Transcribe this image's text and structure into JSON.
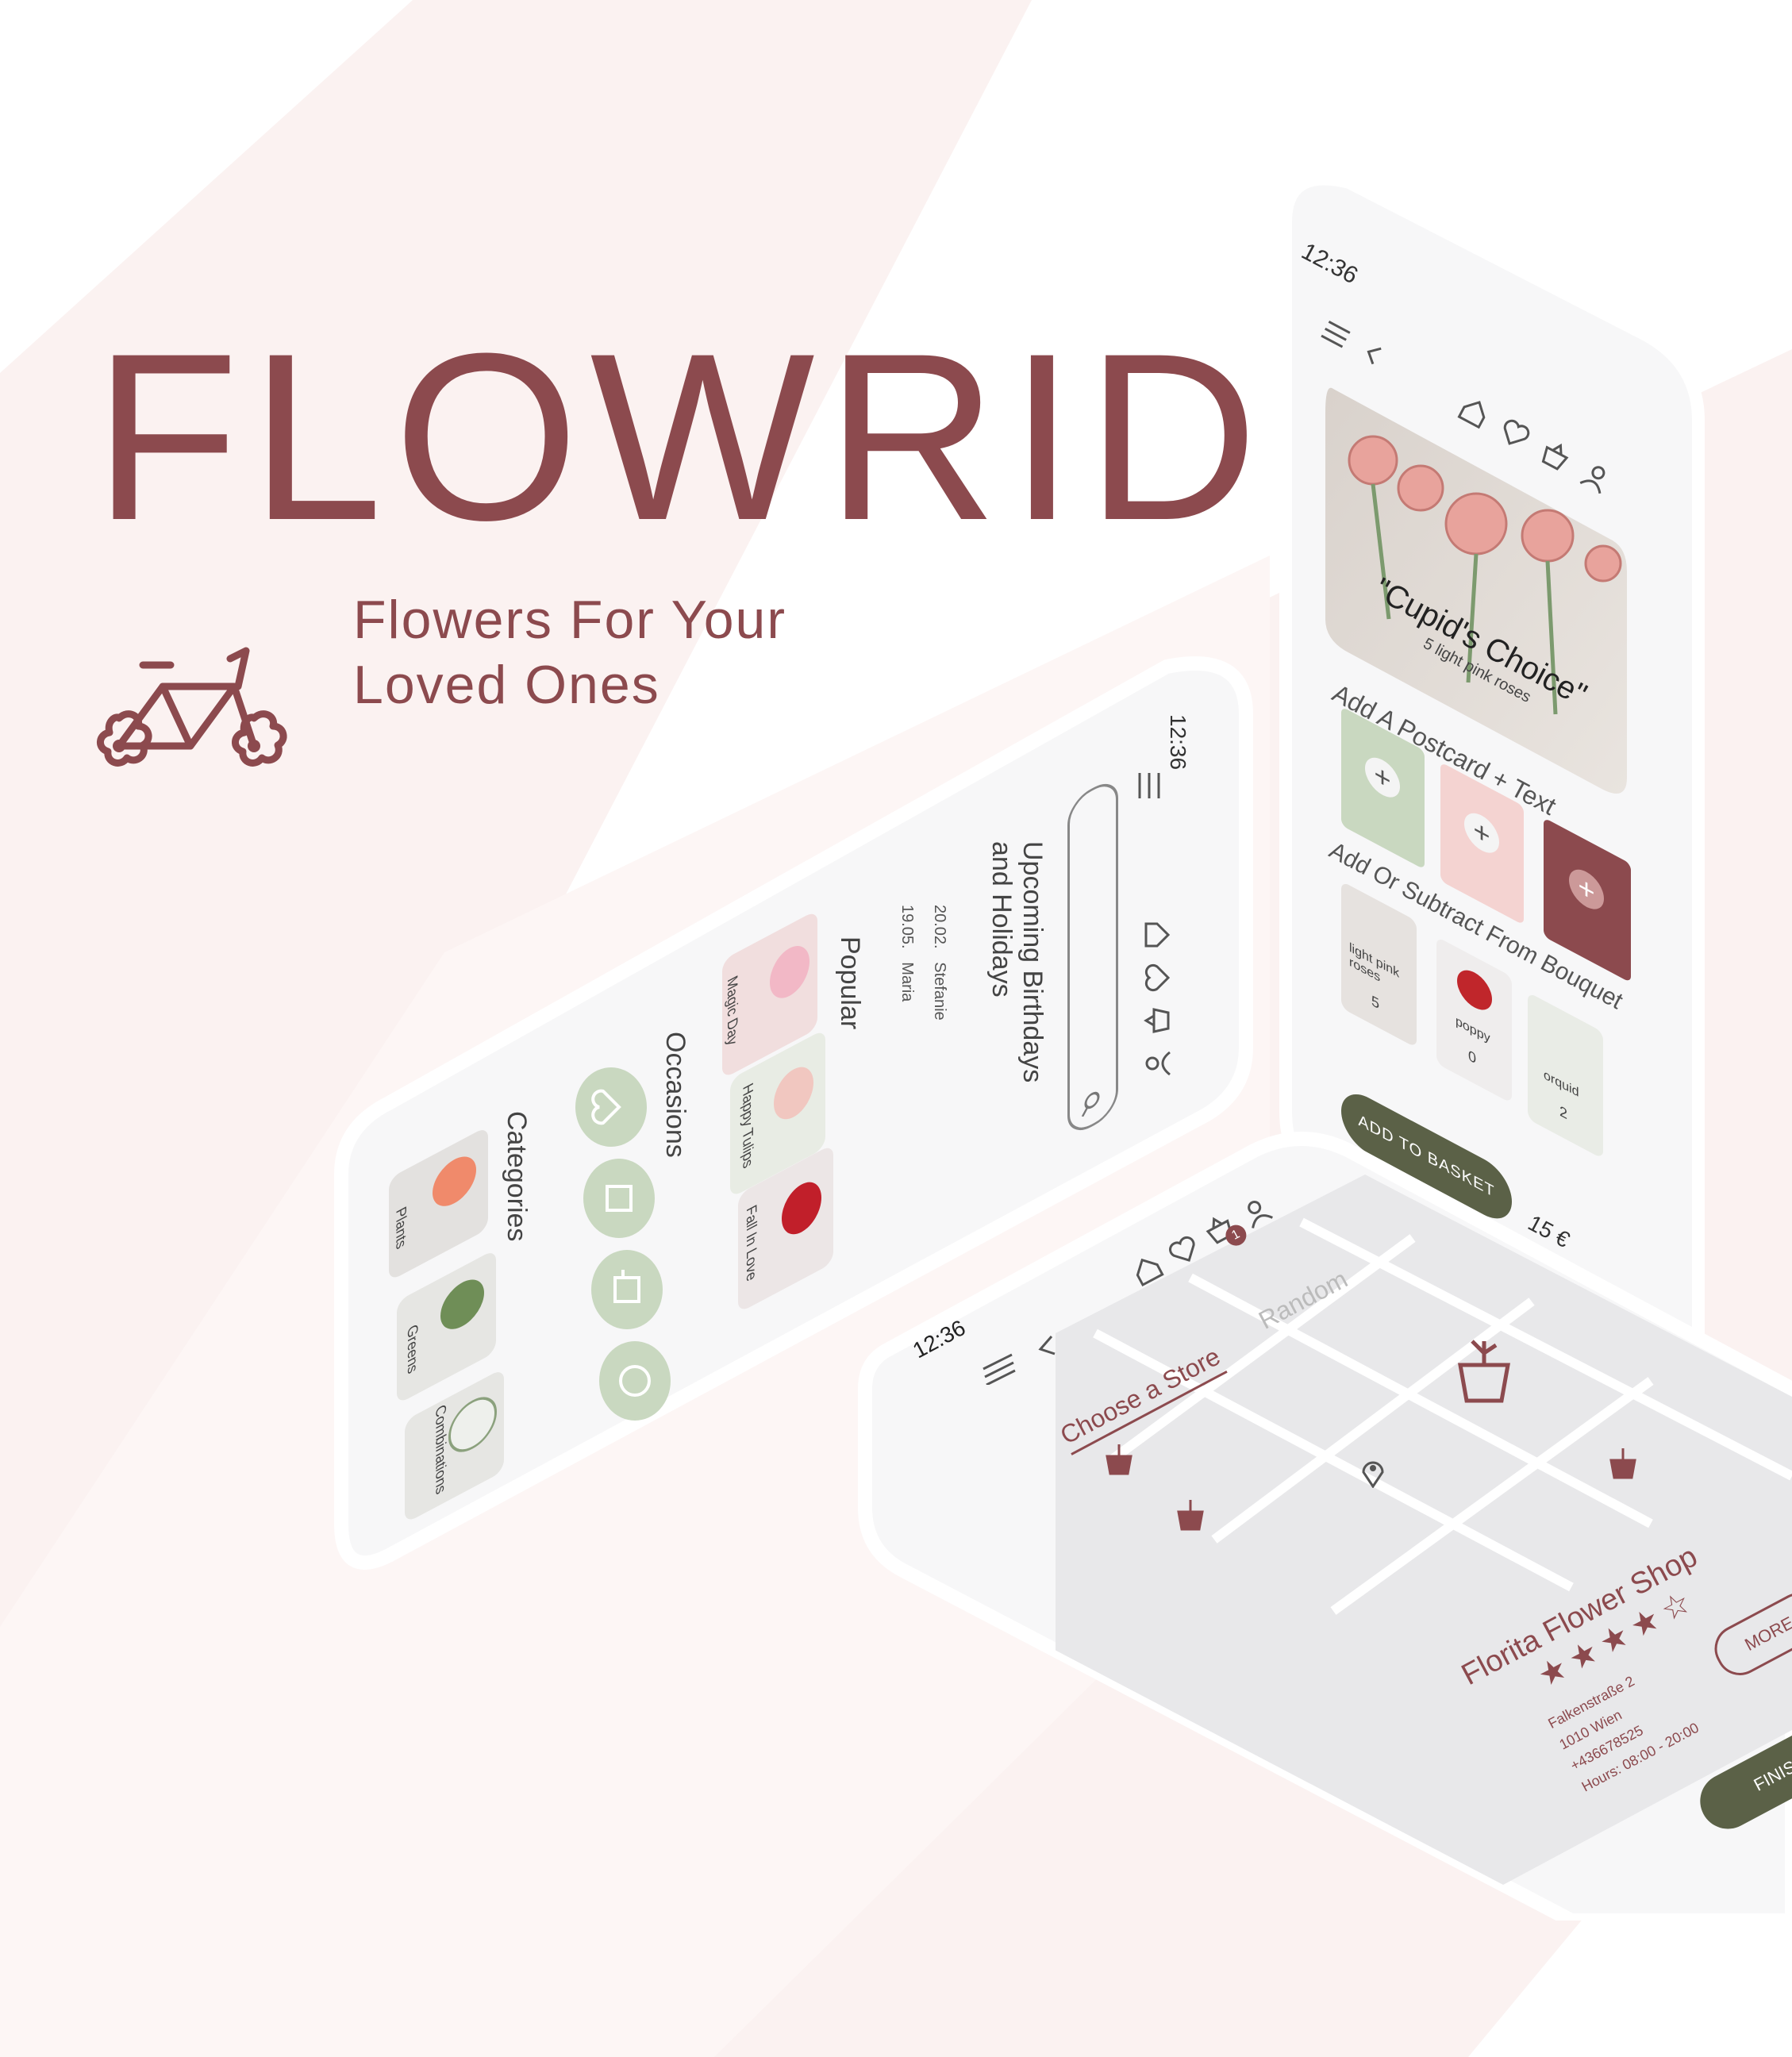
{
  "brand": {
    "title": "FLOWRIDE",
    "tagline_line1": "Flowers For Your",
    "tagline_line2": "Loved Ones",
    "logo_icon": "flower-bicycle-icon"
  },
  "colors": {
    "primary": "#8c4a4e",
    "accent_green": "#c9d8c0",
    "dark_green": "#5b6147",
    "soft_pink": "#f4d3d1",
    "background": "#fbf2f1"
  },
  "phone_right": {
    "status_time": "12:36",
    "product_title": "\"Cupid's Choice\"",
    "product_subtitle": "5 light pink roses",
    "postcard_heading": "Add A Postcard + Text",
    "bouquet_heading": "Add Or Subtract From Bouquet",
    "bouquet_items": [
      {
        "label": "light pink roses",
        "count": "5"
      },
      {
        "label": "poppy",
        "count": "0"
      },
      {
        "label": "orquid",
        "count": "2"
      }
    ],
    "add_to_basket": "ADD TO BASKET",
    "price": "15 €",
    "nav_icons": [
      "menu-icon",
      "back-icon",
      "home-icon",
      "heart-icon",
      "basket-icon",
      "user-icon"
    ]
  },
  "phone_mid": {
    "status_time": "12:36",
    "upcoming_heading_line1": "Upcoming Birthdays",
    "upcoming_heading_line2": "and Holidays",
    "events": [
      {
        "date": "20.02.",
        "name": "Stefanie"
      },
      {
        "date": "19.05.",
        "name": "Maria"
      }
    ],
    "popular_heading": "Popular",
    "popular_items": [
      "Magic Day",
      "Happy Tulips",
      "Fall In Love"
    ],
    "occasions_heading": "Occasions",
    "categories_heading": "Categories",
    "categories": [
      "Plants",
      "Greens",
      "Combinations"
    ]
  },
  "phone_bottom": {
    "status_time": "12:36",
    "tab_active": "Choose a Store",
    "tab_inactive": "Random",
    "basket_count": "1",
    "store_name": "Florita Flower Shop",
    "rating": 4,
    "rating_max": 5,
    "address_line1": "Falkenstraße 2",
    "address_line2": "1010 Wien",
    "phone": "+436678525",
    "hours": "Hours: 08:00 - 20:00",
    "more_button": "MORE",
    "finish_button": "FINISH"
  }
}
